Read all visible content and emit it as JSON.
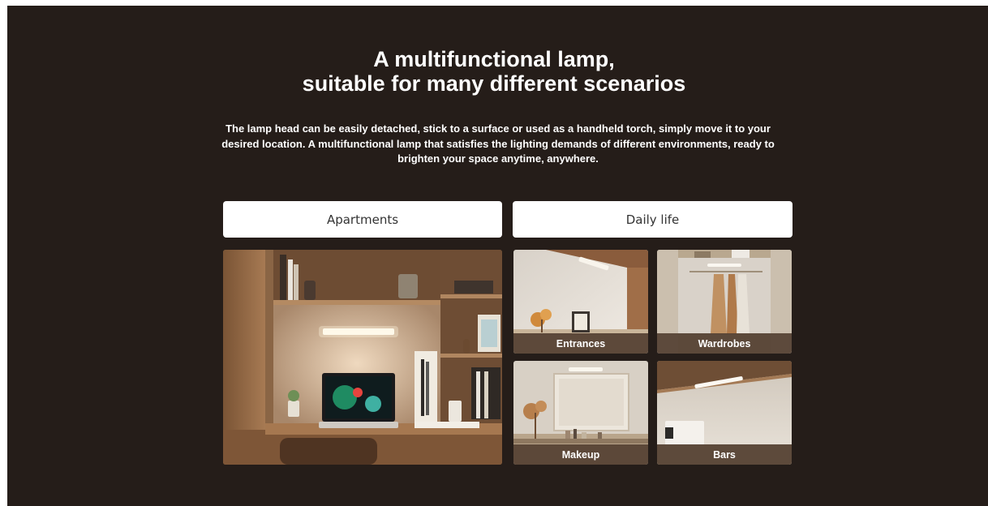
{
  "headline": {
    "line1": "A multifunctional lamp,",
    "line2": "suitable for many different scenarios"
  },
  "description": "The lamp head can be easily detached, stick to a surface or used as a handheld torch, simply move it to your desired location. A multifunctional lamp that satisfies the lighting demands of different environments, ready to brighten your space anytime, anywhere.",
  "tabs": [
    {
      "label": "Apartments"
    },
    {
      "label": "Daily life"
    }
  ],
  "scenes": {
    "main": {
      "caption": ""
    },
    "tiles": [
      {
        "caption": "Entrances"
      },
      {
        "caption": "Wardrobes"
      },
      {
        "caption": "Makeup"
      },
      {
        "caption": "Bars"
      }
    ]
  },
  "colors": {
    "background": "#251d19",
    "tab_background": "#ffffff",
    "caption_bar": "#544032"
  }
}
